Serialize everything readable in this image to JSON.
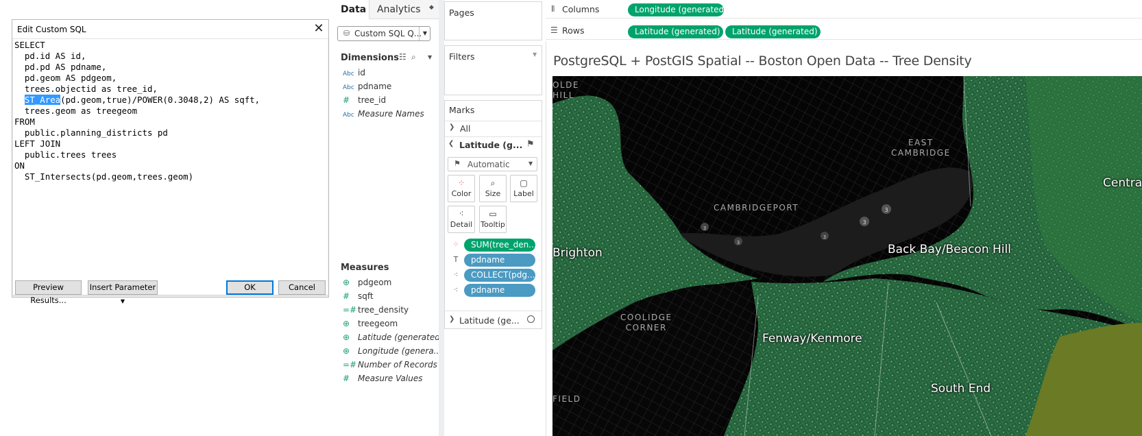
{
  "dialog": {
    "title": "Edit Custom SQL",
    "sql_lines": [
      "SELECT",
      "  pd.id AS id,",
      "  pd.pd AS pdname,",
      "  pd.geom AS pdgeom,",
      "  trees.objectid as tree_id,",
      "(pd.geom,true)/POWER(0.3048,2) AS sqft,",
      "  trees.geom as treegeom",
      "FROM",
      "  public.planning_districts pd",
      "LEFT JOIN",
      "  public.trees trees",
      "ON",
      "  ST_Intersects(pd.geom,trees.geom)"
    ],
    "selected_text": "ST_Area",
    "preview_button": "Preview Results...",
    "insert_param_button": "Insert Parameter",
    "ok_button": "OK",
    "cancel_button": "Cancel"
  },
  "datapane": {
    "tab_data": "Data",
    "tab_analytics": "Analytics",
    "datasource": "Custom SQL Q...",
    "dimensions_header": "Dimensions",
    "dimensions": [
      {
        "type": "Abc",
        "name": "id",
        "italic": false
      },
      {
        "type": "Abc",
        "name": "pdname",
        "italic": false
      },
      {
        "type": "#",
        "name": "tree_id",
        "italic": false
      },
      {
        "type": "Abc",
        "name": "Measure Names",
        "italic": true
      }
    ],
    "measures_header": "Measures",
    "measures": [
      {
        "type": "globe",
        "name": "pdgeom",
        "italic": false
      },
      {
        "type": "#",
        "name": "sqft",
        "italic": false
      },
      {
        "type": "=#",
        "name": "tree_density",
        "italic": false
      },
      {
        "type": "globe",
        "name": "treegeom",
        "italic": false
      },
      {
        "type": "globe",
        "name": "Latitude (generated)",
        "italic": true
      },
      {
        "type": "globe",
        "name": "Longitude (genera...",
        "italic": true
      },
      {
        "type": "=#",
        "name": "Number of Records",
        "italic": true
      },
      {
        "type": "#",
        "name": "Measure Values",
        "italic": true
      }
    ]
  },
  "shelves": {
    "pages": "Pages",
    "filters": "Filters",
    "marks": "Marks",
    "all": "All",
    "layer1": "Latitude (g...",
    "mark_type": "Automatic",
    "cards": [
      "Color",
      "Size",
      "Label",
      "Detail",
      "Tooltip"
    ],
    "mark_pills": [
      "SUM(tree_den...",
      "pdname",
      "COLLECT(pdg...",
      "pdname"
    ],
    "layer2": "Latitude (ge...",
    "columns_label": "Columns",
    "rows_label": "Rows",
    "columns_pill": "Longitude (generated)",
    "rows_pills": [
      "Latitude (generated)",
      "Latitude (generated)"
    ]
  },
  "view": {
    "title": "PostgreSQL + PostGIS Spatial -- Boston Open Data -- Tree Density",
    "labels": {
      "cambridgeport": "CAMBRIDGEPORT",
      "east_cambridge_1": "EAST",
      "east_cambridge_2": "CAMBRIDGE",
      "coolidge_1": "COOLIDGE",
      "coolidge_2": "CORNER",
      "olde_1": "OLDE",
      "olde_2": "HILL",
      "field": "FIELD",
      "brighton": "Brighton",
      "back_bay": "Back Bay/Beacon Hill",
      "fenway": "Fenway/Kenmore",
      "south_end": "South End",
      "central": "Central"
    },
    "route_markers": [
      "3",
      "3",
      "3",
      "3",
      "3"
    ],
    "colors": {
      "dark_green": "#1f5a2e",
      "mid_green": "#2f7a3d",
      "olive": "#6b7a24",
      "water": "#1a1a1a",
      "land": "#000000"
    }
  }
}
